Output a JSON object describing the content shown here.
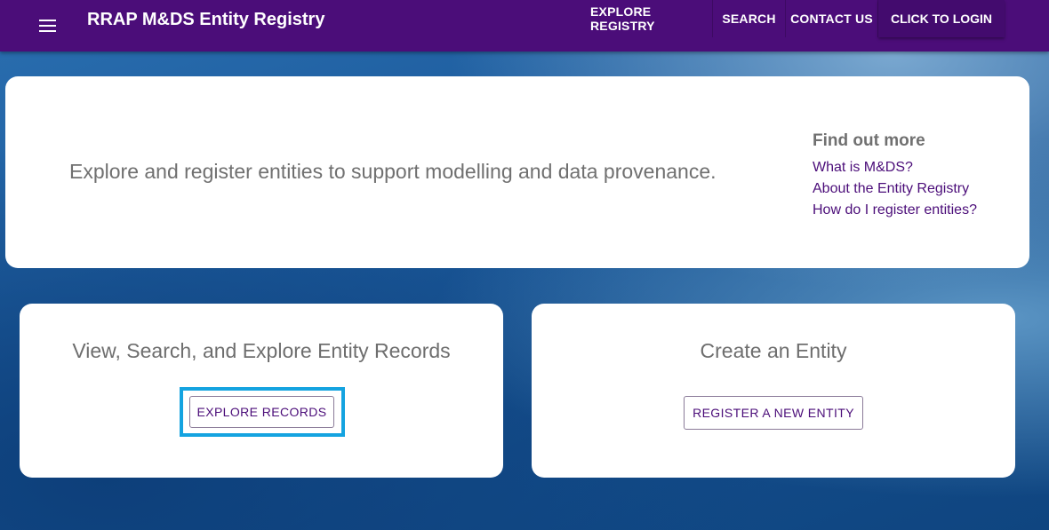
{
  "appbar": {
    "title": "RRAP M&DS Entity Registry",
    "menu_icon": "hamburger-menu-icon",
    "nav": [
      "EXPLORE REGISTRY",
      "SEARCH",
      "CONTACT US"
    ],
    "login_label": "CLICK TO LOGIN",
    "color": "#4b0d79"
  },
  "hero": {
    "tagline": "Explore and register entities to support modelling and data provenance.",
    "find_more": {
      "heading": "Find out more",
      "links": [
        "What is M&DS?",
        "About the Entity Registry",
        "How do I register entities?"
      ]
    }
  },
  "explore_panel": {
    "title": "View, Search, and Explore Entity Records",
    "button_label": "EXPLORE RECORDS"
  },
  "create_panel": {
    "title": "Create an Entity",
    "button_label": "REGISTER A NEW ENTITY"
  },
  "colors": {
    "accent": "#4b0d79",
    "highlight": "#14a3e0"
  }
}
